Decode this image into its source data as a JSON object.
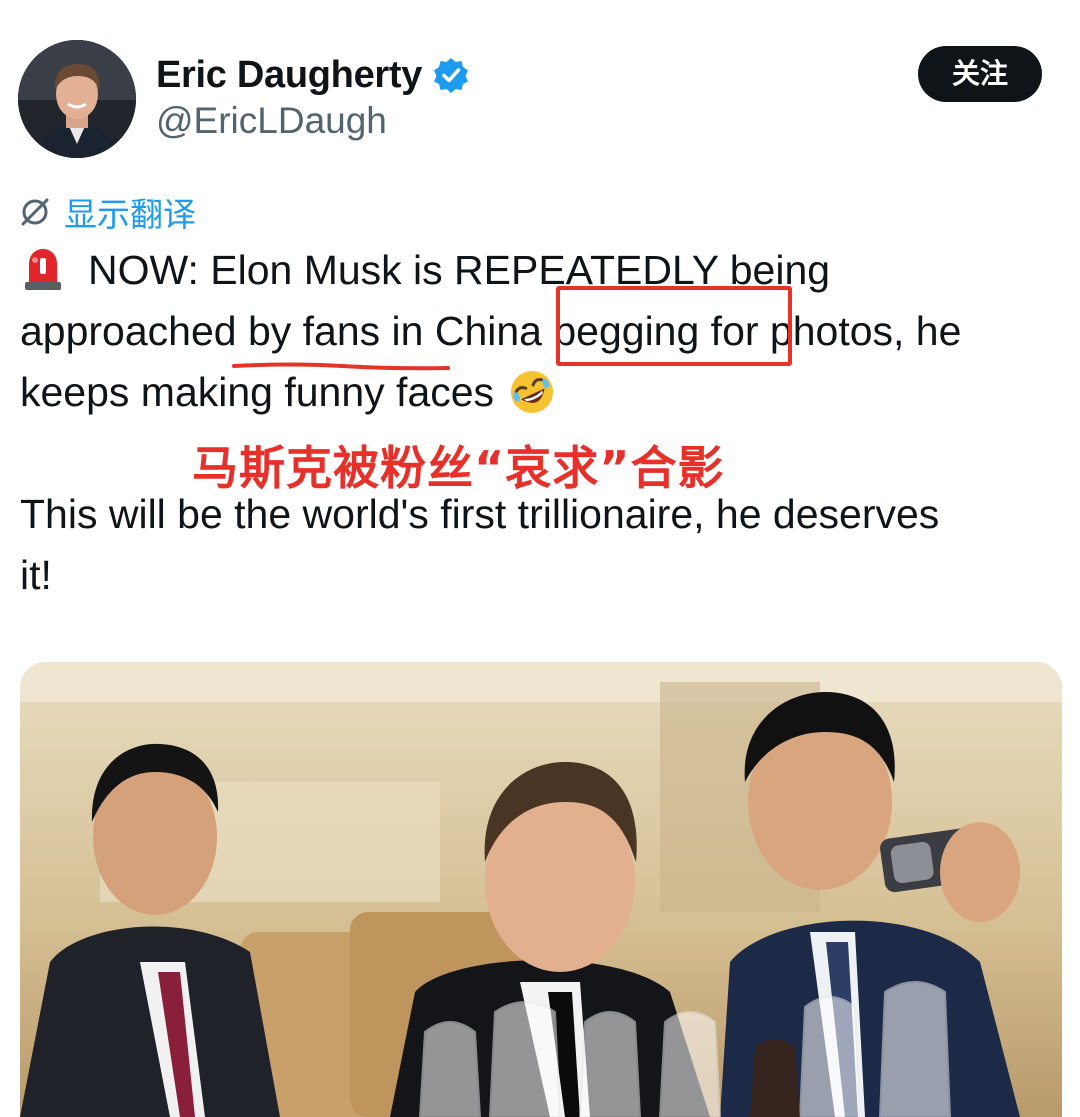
{
  "header": {
    "display_name": "Eric Daugherty",
    "handle": "@EricLDaugh",
    "follow_label": "关注"
  },
  "translate": {
    "label": "显示翻译"
  },
  "post": {
    "line1": "NOW: Elon Musk is REPEATEDLY being",
    "line2": "approached by fans in China begging for photos, he",
    "line3": "keeps making funny faces",
    "line4": "This will be the world's first trillionaire, he deserves",
    "line5": "it!"
  },
  "overlay": {
    "annotation": "马斯克被粉丝“哀求”合影",
    "highlight_color": "#e5332a"
  },
  "icons": {
    "alert": "police-light-icon",
    "emoji": "rolling-on-floor-laughing-icon",
    "verified": "verified-badge-icon",
    "translate": "translate-icon"
  },
  "colors": {
    "accent": "#1d9bf0",
    "text": "#0f1419",
    "secondary": "#536471",
    "annotation_red": "#e8302a"
  }
}
